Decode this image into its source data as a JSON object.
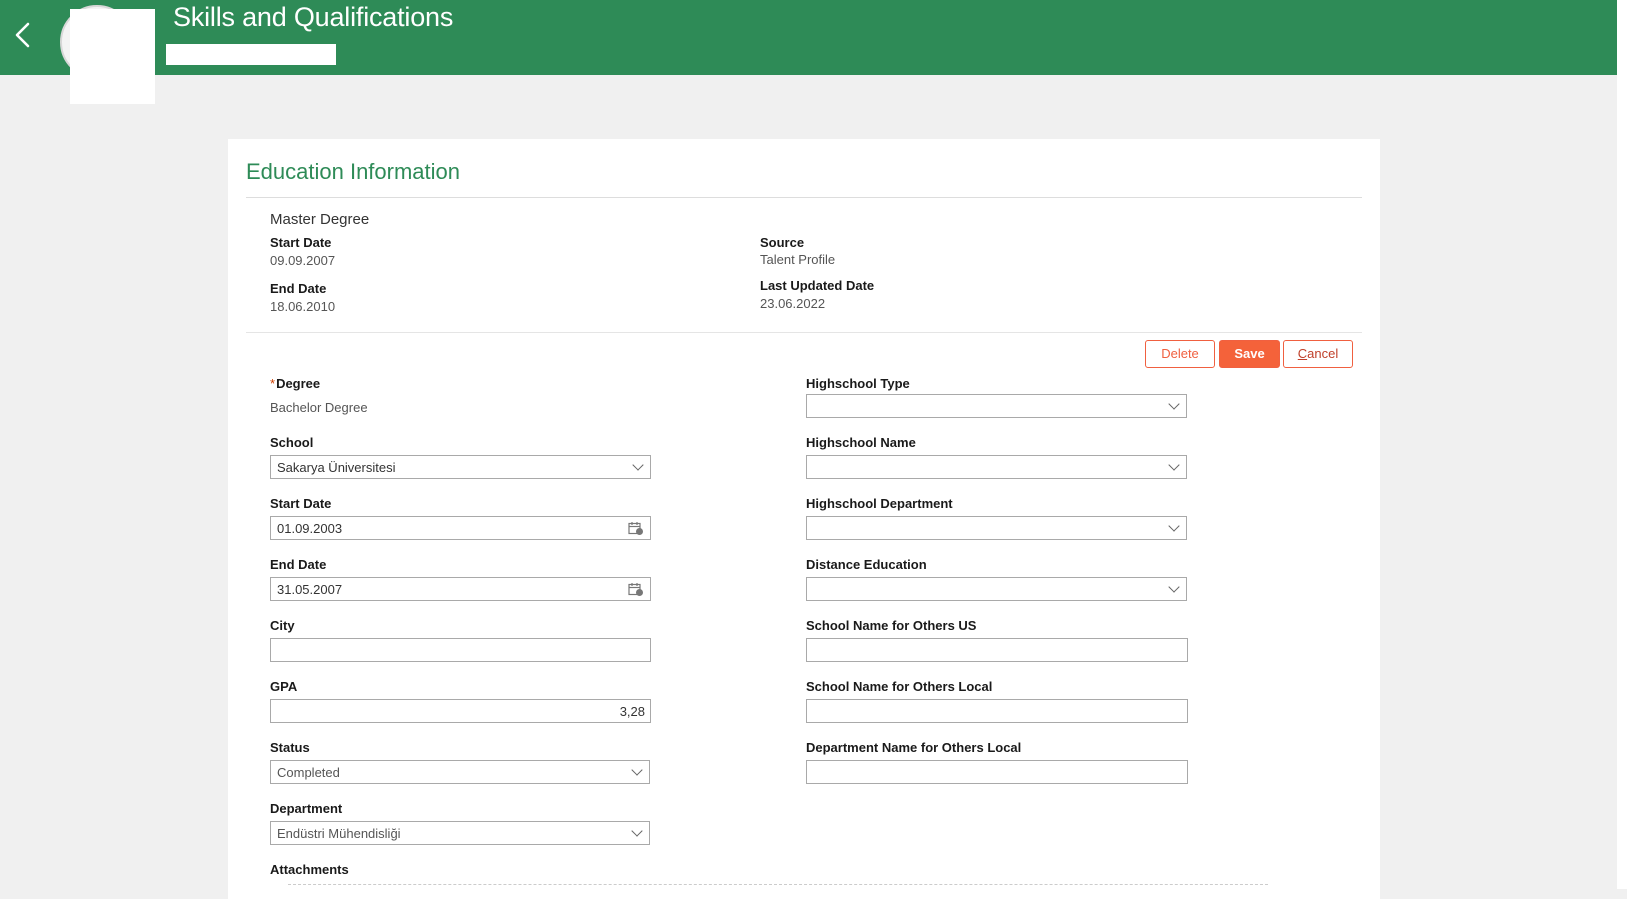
{
  "header": {
    "title": "Skills and Qualifications"
  },
  "card": {
    "title": "Education Information",
    "summary": {
      "degree": "Master Degree",
      "start_date_label": "Start Date",
      "start_date": "09.09.2007",
      "end_date_label": "End Date",
      "end_date": "18.06.2010",
      "source_label": "Source",
      "source": "Talent Profile",
      "last_updated_label": "Last Updated Date",
      "last_updated": "23.06.2022"
    },
    "actions": {
      "delete": "Delete",
      "save": "Save",
      "cancel_first": "C",
      "cancel_rest": "ancel"
    },
    "form": {
      "degree_required": "*",
      "degree_label": "Degree",
      "degree_value": "Bachelor Degree",
      "school_label": "School",
      "school_value": "Sakarya Üniversitesi",
      "start_date_label": "Start Date",
      "start_date_value": "01.09.2003",
      "end_date_label": "End Date",
      "end_date_value": "31.05.2007",
      "city_label": "City",
      "city_value": "",
      "gpa_label": "GPA",
      "gpa_value": "3,28",
      "status_label": "Status",
      "status_value": "Completed",
      "department_label": "Department",
      "department_value": "Endüstri Mühendisliği",
      "attachments_label": "Attachments",
      "highschool_type_label": "Highschool Type",
      "highschool_type_value": "",
      "highschool_name_label": "Highschool Name",
      "highschool_name_value": "",
      "highschool_department_label": "Highschool Department",
      "highschool_department_value": "",
      "distance_education_label": "Distance Education",
      "distance_education_value": "",
      "school_others_us_label": "School Name for Others US",
      "school_others_us_value": "",
      "school_others_local_label": "School Name for Others Local",
      "school_others_local_value": "",
      "department_others_local_label": "Department Name for Others Local",
      "department_others_local_value": ""
    }
  },
  "colors": {
    "header_green": "#2e8b57",
    "accent_orange": "#f4623a",
    "title_green": "#2e8b57"
  }
}
